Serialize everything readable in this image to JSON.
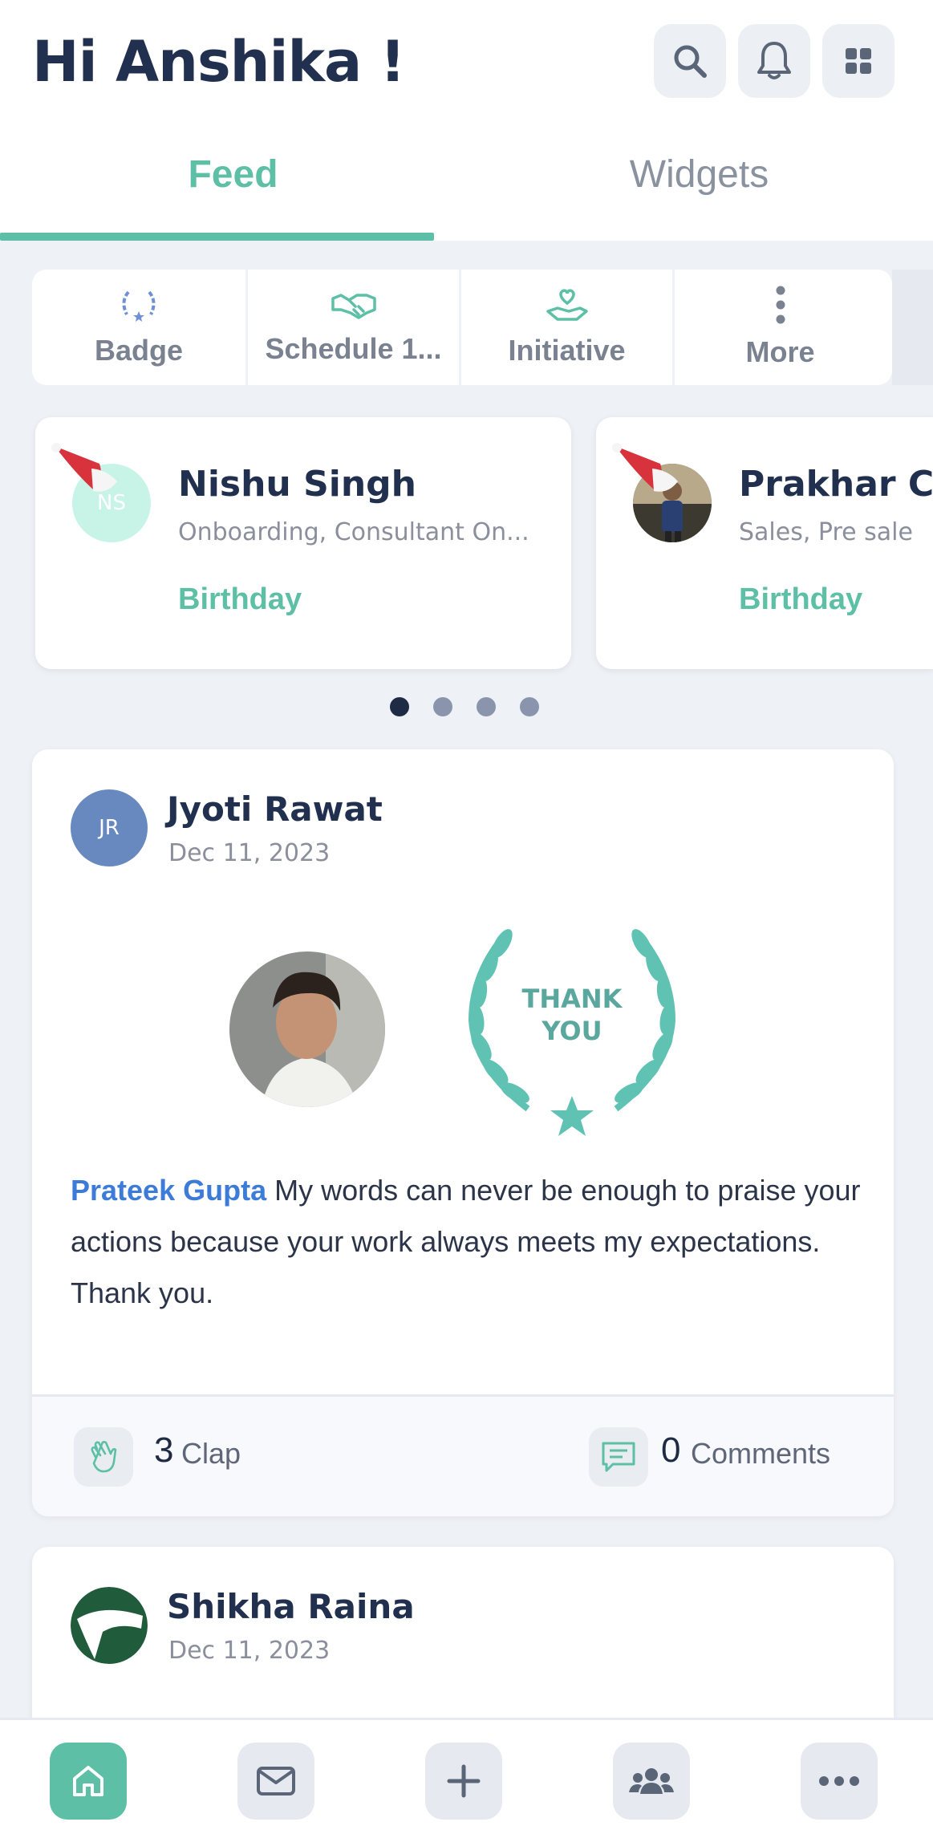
{
  "header": {
    "greeting": "Hi Anshika !",
    "icons": [
      "search-icon",
      "bell-icon",
      "apps-grid-icon"
    ]
  },
  "tabs": [
    {
      "label": "Feed",
      "active": true
    },
    {
      "label": "Widgets",
      "active": false
    }
  ],
  "quick_actions": [
    {
      "label": "Badge",
      "icon": "badge-laurel-icon"
    },
    {
      "label": "Schedule 1...",
      "icon": "handshake-icon"
    },
    {
      "label": "Initiative",
      "icon": "heart-hand-icon"
    },
    {
      "label": "More",
      "icon": "more-vertical-icon"
    }
  ],
  "birthdays": [
    {
      "initials": "NS",
      "name": "Nishu Singh",
      "dept": "Onboarding, Consultant On...",
      "type": "Birthday"
    },
    {
      "initials": "",
      "name": "Prakhar C",
      "dept": "Sales, Pre sale",
      "type": "Birthday"
    }
  ],
  "carousel": {
    "pages": 4,
    "active_index": 0
  },
  "posts": [
    {
      "initials": "JR",
      "author": "Jyoti Rawat",
      "date": "Dec 11, 2023",
      "badge_text_line1": "THANK",
      "badge_text_line2": "YOU",
      "mention": "Prateek Gupta",
      "message": " My words can never be enough to praise your actions because your work always meets my expectations. Thank you.",
      "claps": "3",
      "clap_label": "Clap",
      "comments": "0",
      "comments_label": "Comments"
    },
    {
      "initials": "",
      "author": "Shikha Raina",
      "date": "Dec 11, 2023"
    }
  ],
  "bottom_nav": [
    {
      "icon": "home-icon",
      "active": true
    },
    {
      "icon": "mail-icon",
      "active": false
    },
    {
      "icon": "plus-icon",
      "active": false
    },
    {
      "icon": "people-icon",
      "active": false
    },
    {
      "icon": "more-horizontal-icon",
      "active": false
    }
  ],
  "colors": {
    "accent": "#5cbfa6",
    "mention": "#3d7bd8",
    "title": "#22304f",
    "background": "#eef1f6"
  }
}
